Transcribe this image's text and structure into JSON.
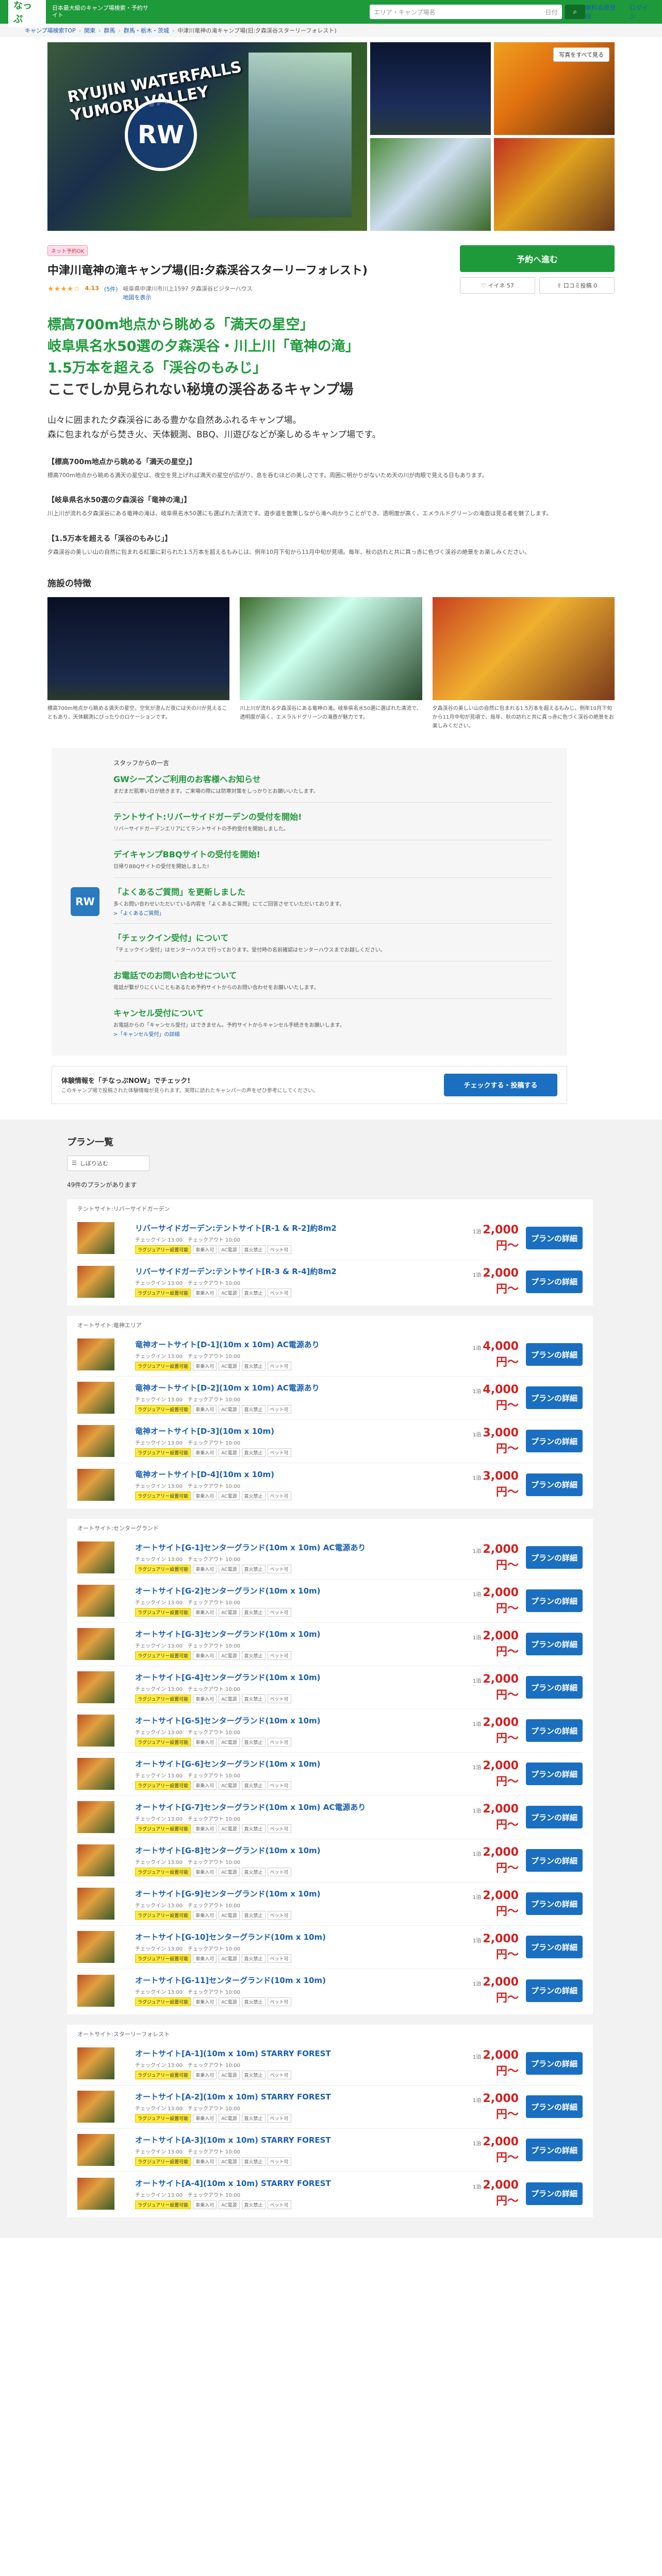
{
  "header": {
    "logo": "なっぷ",
    "tagline": "日本最大級のキャンプ場検索・予約サイト",
    "search_placeholder": "エリア・キャンプ場名",
    "search_suffix": "日付",
    "nav": [
      "無料会員登録",
      "ログイン"
    ]
  },
  "breadcrumb": [
    "キャンプ場検索TOP",
    "関東",
    "群馬",
    "群馬・栃木・茨城",
    "中津川竜神の滝キャンプ場(旧:夕森渓谷スターリーフォレスト)"
  ],
  "gallery": {
    "logo_text": "RYUJIN WATERFALLS\nYUMORI VALLEY",
    "emblem": "RW",
    "more_label": "写真をすべて見る"
  },
  "title": {
    "tag": "ネット予約OK",
    "name": "中津川竜神の滝キャンプ場(旧:夕森渓谷スターリーフォレスト)",
    "stars": "★★★★☆",
    "score": "4.13",
    "reviews": "(5件)",
    "address": "岐阜県中津川市川上1597 夕森渓谷ビジターハウス",
    "map_link": "地図を表示"
  },
  "actions": {
    "reserve": "予約へ進む",
    "favorite": "♡ イイネ 57",
    "share": "⇪ 口コミ投稿 0"
  },
  "catch": {
    "line1": "標高700m地点から眺める「満天の星空」",
    "line2": "岐阜県名水50選の夕森渓谷・川上川「竜神の滝」",
    "line3": "1.5万本を超える「渓谷のもみじ」",
    "line4": "ここでしか見られない秘境の渓谷あるキャンプ場"
  },
  "lead": "山々に囲まれた夕森渓谷にある豊かな自然あふれるキャンプ場。\n森に包まれながら焚き火、天体観測、BBQ、川遊びなどが楽しめるキャンプ場です。",
  "sections": [
    {
      "title": "【標高700m地点から眺める「満天の星空」】",
      "text": "標高700m地点から眺める満天の星空は、夜空を見上げれば満天の星空が広がり、息を呑むほどの美しさです。周囲に明かりがないため天の川が肉眼で見える日もあります。"
    },
    {
      "title": "【岐阜県名水50選の夕森渓谷「竜神の滝」】",
      "text": "川上川が流れる夕森渓谷にある竜神の滝は、岐阜県名水50選にも選ばれた清流です。遊歩道を散策しながら滝へ向かうことができ、透明度が高く、エメラルドグリーンの滝壺は見る者を魅了します。"
    },
    {
      "title": "【1.5万本を超える「渓谷のもみじ」】",
      "text": "夕森渓谷の美しい山の自然に包まれる紅葉に彩られた1.5万本を超えるもみじは、例年10月下旬から11月中旬が見頃。毎年、秋の訪れと共に真っ赤に色づく渓谷の絶景をお楽しみください。"
    }
  ],
  "features": {
    "heading": "施設の特徴",
    "items": [
      "標高700m地点から眺める満天の星空。空気が澄んだ夜には天の川が見えることもあり、天体観測にぴったりのロケーションです。",
      "川上川が流れる夕森渓谷にある竜神の滝。岐阜県名水50選に選ばれた清流で、透明度が高く、エメラルドグリーンの滝壺が魅力です。",
      "夕森渓谷の美しい山の自然に包まれる1.5万本を超えるもみじ。例年10月下旬から11月中旬が見頃で、毎年、秋の訪れと共に真っ赤に色づく渓谷の絶景をお楽しみください。"
    ]
  },
  "news": {
    "from": "スタッフからの一言",
    "emblem": "RW",
    "items": [
      {
        "title": "GWシーズンご利用のお客様へお知らせ",
        "text": "まだまだ肌寒い日が続きます。ご来場の際には防寒対策をしっかりとお願いいたします。",
        "link": ""
      },
      {
        "title": "テントサイト:リバーサイドガーデンの受付を開始!",
        "text": "リバーサイドガーデンエリアにてテントサイトの予約受付を開始しました。",
        "link": ""
      },
      {
        "title": "デイキャンプBBQサイトの受付を開始!",
        "text": "日帰りBBQサイトの受付を開始しました!",
        "link": ""
      },
      {
        "title": "「よくあるご質問」を更新しました",
        "text": "多くお問い合わせいただいている内容を「よくあるご質問」にてご回答させていただいております。",
        "link": ">「よくあるご質問」"
      },
      {
        "title": "「チェックイン受付」について",
        "text": "「チェックイン受付」はセンターハウスで行っております。受付時の名前確認はセンターハウスまでお越しください。",
        "link": ""
      },
      {
        "title": "お電話でのお問い合わせについて",
        "text": "電話が繋がりにくいこともあるため予約サイトからのお問い合わせをお願いいたします。",
        "link": ""
      },
      {
        "title": "キャンセル受付について",
        "text": "お電話からの「キャンセル受付」はできません。予約サイトからキャンセル手続きをお願いします。",
        "link": ">「キャンセル受付」の詳細"
      }
    ]
  },
  "promo": {
    "title": "体験情報を「チなっぷNOW」でチェック!",
    "text": "このキャンプ場で投稿された体験情報が見られます。実際に訪れたキャンパーの声をぜひ参考にしてください。",
    "button": "チェックする・投稿する"
  },
  "plans": {
    "heading": "プラン一覧",
    "search": "しぼり込む",
    "count": "49件のプランがあります",
    "groups": [
      {
        "label": "テントサイト:リバーサイドガーデン",
        "items": [
          {
            "name": "リバーサイドガーデン:テントサイト[R-1 & R-2]約8m2",
            "price": "2,000円〜"
          },
          {
            "name": "リバーサイドガーデン:テントサイト[R-3 & R-4]約8m2",
            "price": "2,000円〜"
          }
        ]
      },
      {
        "label": "オートサイト:竜神エリア",
        "items": [
          {
            "name": "竜神オートサイト[D-1](10m x 10m) AC電源あり",
            "price": "4,000円〜"
          },
          {
            "name": "竜神オートサイト[D-2](10m x 10m) AC電源あり",
            "price": "4,000円〜"
          },
          {
            "name": "竜神オートサイト[D-3](10m x 10m)",
            "price": "3,000円〜"
          },
          {
            "name": "竜神オートサイト[D-4](10m x 10m)",
            "price": "3,000円〜"
          }
        ]
      },
      {
        "label": "オートサイト:センターグランド",
        "items": [
          {
            "name": "オートサイト[G-1]センターグランド(10m x 10m) AC電源あり",
            "price": "2,000円〜"
          },
          {
            "name": "オートサイト[G-2]センターグランド(10m x 10m)",
            "price": "2,000円〜"
          },
          {
            "name": "オートサイト[G-3]センターグランド(10m x 10m)",
            "price": "2,000円〜"
          },
          {
            "name": "オートサイト[G-4]センターグランド(10m x 10m)",
            "price": "2,000円〜"
          },
          {
            "name": "オートサイト[G-5]センターグランド(10m x 10m)",
            "price": "2,000円〜"
          },
          {
            "name": "オートサイト[G-6]センターグランド(10m x 10m)",
            "price": "2,000円〜"
          },
          {
            "name": "オートサイト[G-7]センターグランド(10m x 10m) AC電源あり",
            "price": "2,000円〜"
          },
          {
            "name": "オートサイト[G-8]センターグランド(10m x 10m)",
            "price": "2,000円〜"
          },
          {
            "name": "オートサイト[G-9]センターグランド(10m x 10m)",
            "price": "2,000円〜"
          },
          {
            "name": "オートサイト[G-10]センターグランド(10m x 10m)",
            "price": "2,000円〜"
          },
          {
            "name": "オートサイト[G-11]センターグランド(10m x 10m)",
            "price": "2,000円〜"
          }
        ]
      },
      {
        "label": "オートサイト:スターリーフォレスト",
        "items": [
          {
            "name": "オートサイト[A-1](10m x 10m) STARRY FOREST",
            "price": "2,000円〜"
          },
          {
            "name": "オートサイト[A-2](10m x 10m) STARRY FOREST",
            "price": "2,000円〜"
          },
          {
            "name": "オートサイト[A-3](10m x 10m) STARRY FOREST",
            "price": "2,000円〜"
          },
          {
            "name": "オートサイト[A-4](10m x 10m) STARRY FOREST",
            "price": "2,000円〜"
          }
        ]
      }
    ],
    "time": "チェックイン 13:00　チェックアウト 10:00",
    "badges": [
      "ラグジュアリー設置可能",
      "車乗入可",
      "AC電源",
      "直火禁止",
      "ペット可"
    ],
    "price_prefix": "1泊",
    "button": "プランの詳細"
  }
}
